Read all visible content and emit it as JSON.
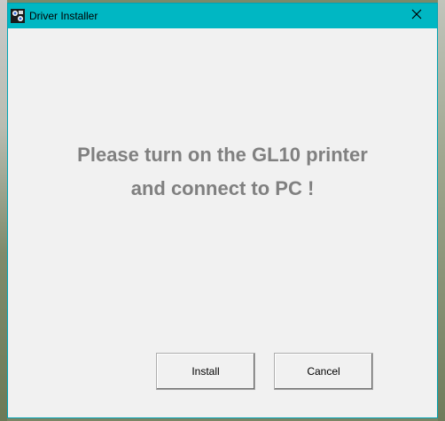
{
  "window": {
    "title": "Driver Installer",
    "app_icon": "printer-app-icon",
    "close_icon": "close-icon",
    "accent_color": "#00b7c3"
  },
  "content": {
    "message_line1": "Please turn on the GL10 printer",
    "message_line2": "and connect to PC !",
    "message_color": "#808080"
  },
  "buttons": {
    "install_label": "Install",
    "cancel_label": "Cancel"
  }
}
